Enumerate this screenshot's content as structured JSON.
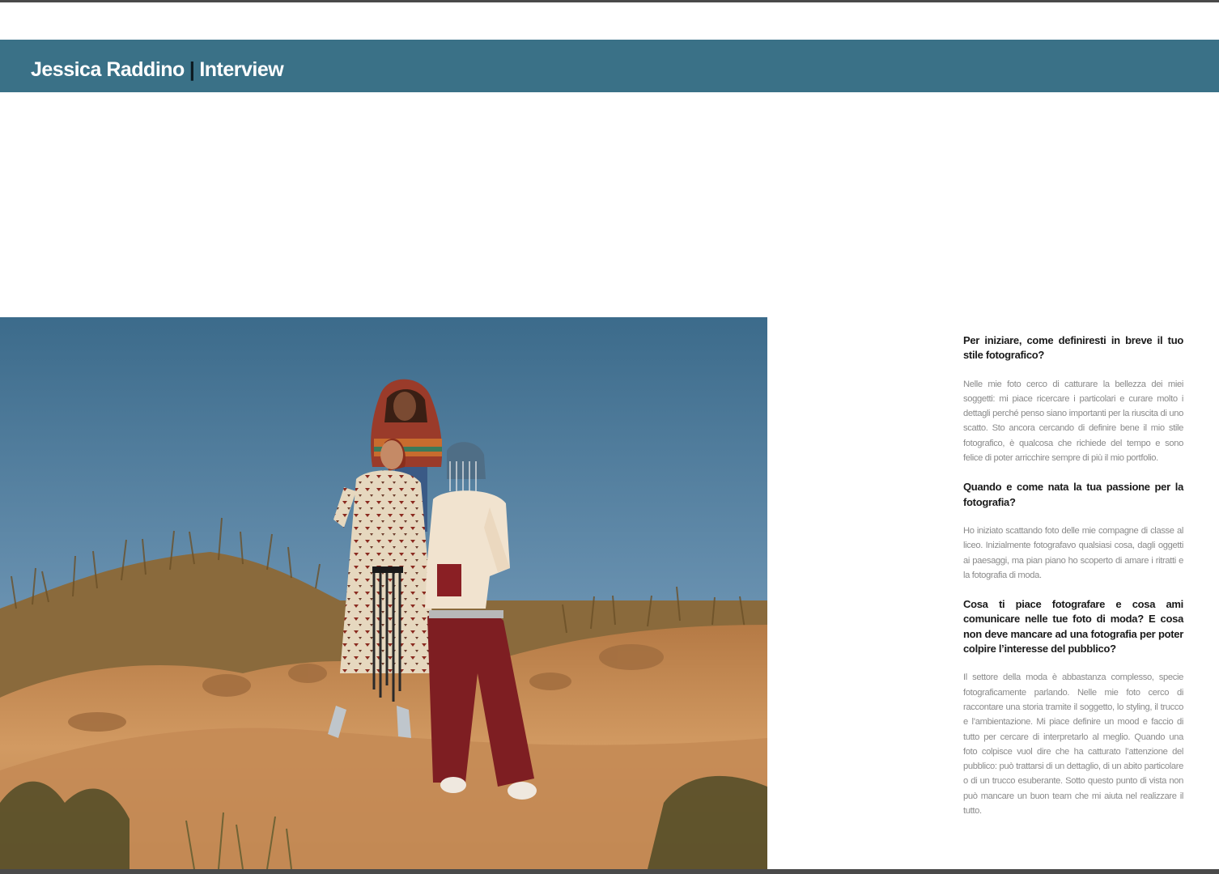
{
  "header": {
    "name": "Jessica Raddino",
    "separator": "|",
    "section": "Interview"
  },
  "photo": {
    "subject": "fashion-photo"
  },
  "interview": [
    {
      "question": "Per iniziare, come definiresti in breve il tuo stile fotografico?",
      "answer": "Nelle mie foto cerco di catturare la bellezza dei miei soggetti: mi piace ricercare i particolari e curare molto i dettagli perché penso siano importanti per la riuscita di uno scatto. Sto ancora cercando di definire bene il mio stile fotografico, è qualcosa che richiede del tempo e sono felice di poter arricchire sempre di più il mio portfolio."
    },
    {
      "question": "Quando e come nata la tua passione per la fotografia?",
      "answer": "Ho iniziato scattando foto delle mie compagne di classe al liceo. Inizialmente fotografavo qualsiasi cosa, dagli oggetti ai paesaggi, ma pian piano ho scoperto di amare i ritratti e la fotografia di moda."
    },
    {
      "question": "Cosa ti piace fotografare e cosa ami comunicare nelle tue foto di moda? E cosa non deve mancare ad una fotografia per poter colpire l’interesse del pubblico?",
      "answer": "Il settore della moda è abbastanza complesso, specie fotograficamente parlando. Nelle mie foto cerco di raccontare una storia tramite il soggetto, lo styling, il trucco e l’ambientazione. Mi piace definire un mood e faccio di tutto per cercare di interpretarlo al meglio. Quando una foto colpisce vuol dire che ha catturato l’attenzione del pubblico: può trattarsi di un dettaglio, di un abito particolare o di un trucco esuberante. Sotto questo punto di vista non può mancare un buon team che mi aiuta nel realizzare il tutto."
    }
  ],
  "colors": {
    "header_band": "#3a7187",
    "header_text": "#ffffff",
    "question_text": "#1a1a1a",
    "answer_text": "#8a8a8a",
    "sky_top": "#3f6f8f",
    "sky_bottom": "#86aac6",
    "sand": "#c9935d"
  }
}
